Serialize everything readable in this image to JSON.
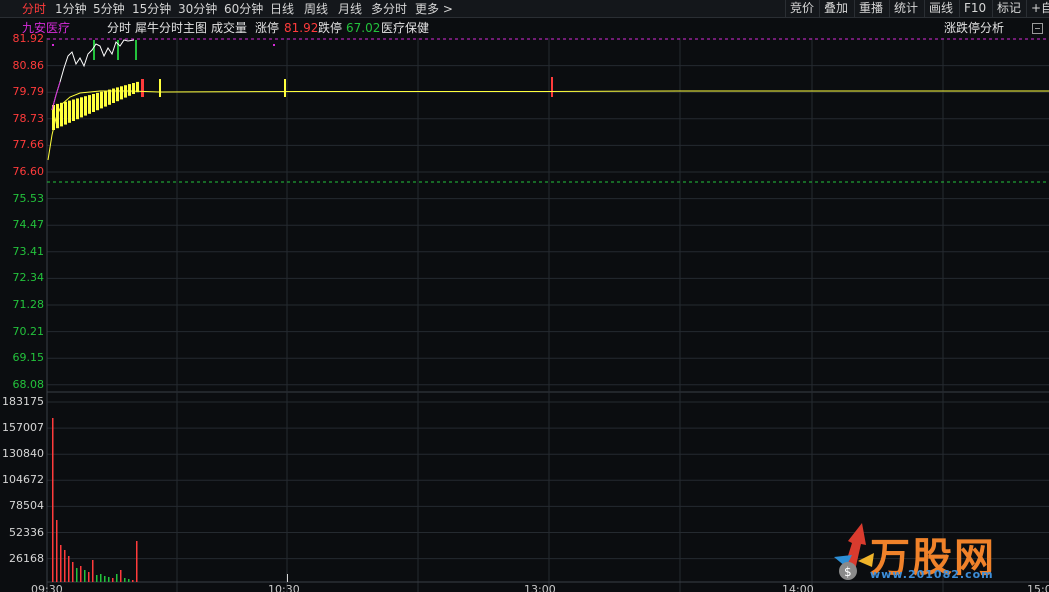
{
  "period_tabs": [
    "分时",
    "1分钟",
    "5分钟",
    "15分钟",
    "30分钟",
    "60分钟",
    "日线",
    "周线",
    "月线",
    "多分时",
    "更多 >"
  ],
  "right_buttons": [
    "竞价",
    "叠加",
    "重播",
    "统计",
    "画线",
    "F10",
    "标记",
    "+自"
  ],
  "info_bar": {
    "stock_name": "九安医疗",
    "mode": "分时",
    "indicator": "犀牛分时主图",
    "volume_label": "成交量",
    "limit_up_label": "涨停",
    "limit_up_value": "81.92",
    "limit_down_label": "跌停",
    "limit_down_value": "67.02",
    "sector": "医疗保健",
    "right_label": "涨跌停分析"
  },
  "price_axis": [
    "81.92",
    "80.86",
    "79.79",
    "78.73",
    "77.66",
    "76.60",
    "75.53",
    "74.47",
    "73.41",
    "72.34",
    "71.28",
    "70.21",
    "69.15",
    "68.08"
  ],
  "volume_axis": [
    "183175",
    "157007",
    "130840",
    "104672",
    "78504",
    "52336",
    "26168"
  ],
  "time_axis": [
    "09:30",
    "10:30",
    "13:00",
    "14:00",
    "15:00"
  ],
  "watermark": {
    "brand": "万股网",
    "url": "www.201082.com"
  },
  "colors": {
    "up": "#ff3b3b",
    "down": "#23c23c",
    "avg_line": "#ffff3c",
    "price_line": "#ffffff",
    "limit_line": "#d42bd8",
    "grid": "#252a30"
  }
}
